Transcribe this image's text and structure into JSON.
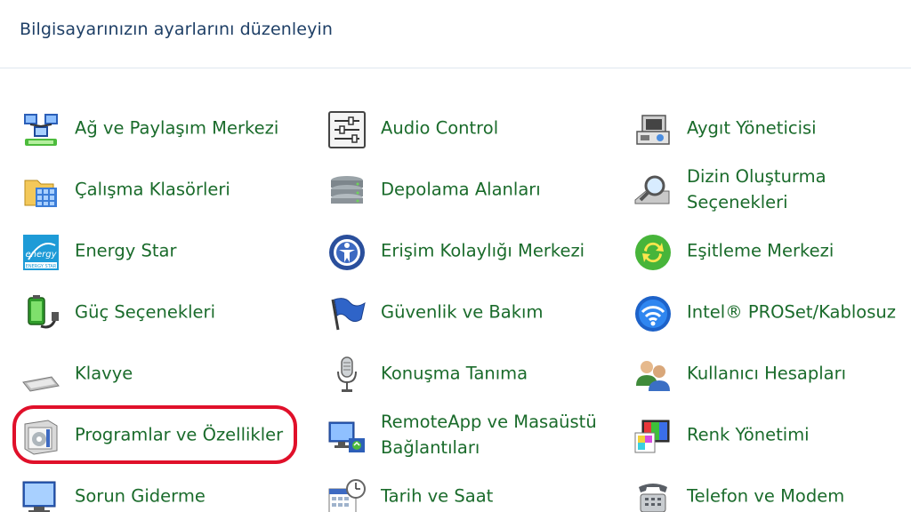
{
  "header": {
    "title": "Bilgisayarınızın ayarlarını düzenleyin"
  },
  "items": {
    "ag": "Ağ ve Paylaşım Merkezi",
    "audio": "Audio Control",
    "aygit": "Aygıt Yöneticisi",
    "calisma": "Çalışma Klasörleri",
    "depolama": "Depolama Alanları",
    "dizin_1": "Dizin Oluşturma",
    "dizin_2": "Seçenekleri",
    "energy": "Energy Star",
    "erisim": "Erişim Kolaylığı Merkezi",
    "esitleme": "Eşitleme Merkezi",
    "guc": "Güç Seçenekleri",
    "guvenlik": "Güvenlik ve Bakım",
    "intel": "Intel® PROSet/Kablosuz",
    "klavye": "Klavye",
    "konusma": "Konuşma Tanıma",
    "kullanici": "Kullanıcı Hesapları",
    "programlar": "Programlar ve Özellikler",
    "remote_1": "RemoteApp ve Masaüstü",
    "remote_2": "Bağlantıları",
    "renk": "Renk Yönetimi",
    "sorun": "Sorun Giderme",
    "tarih": "Tarih ve Saat",
    "telefon": "Telefon ve Modem"
  },
  "energy_icon_text": "energy",
  "energy_icon_subtext": "ENERGY STAR",
  "colors": {
    "link_green": "#1a6b2b",
    "header_blue": "#1e3f66",
    "highlight_red": "#e0102a"
  }
}
